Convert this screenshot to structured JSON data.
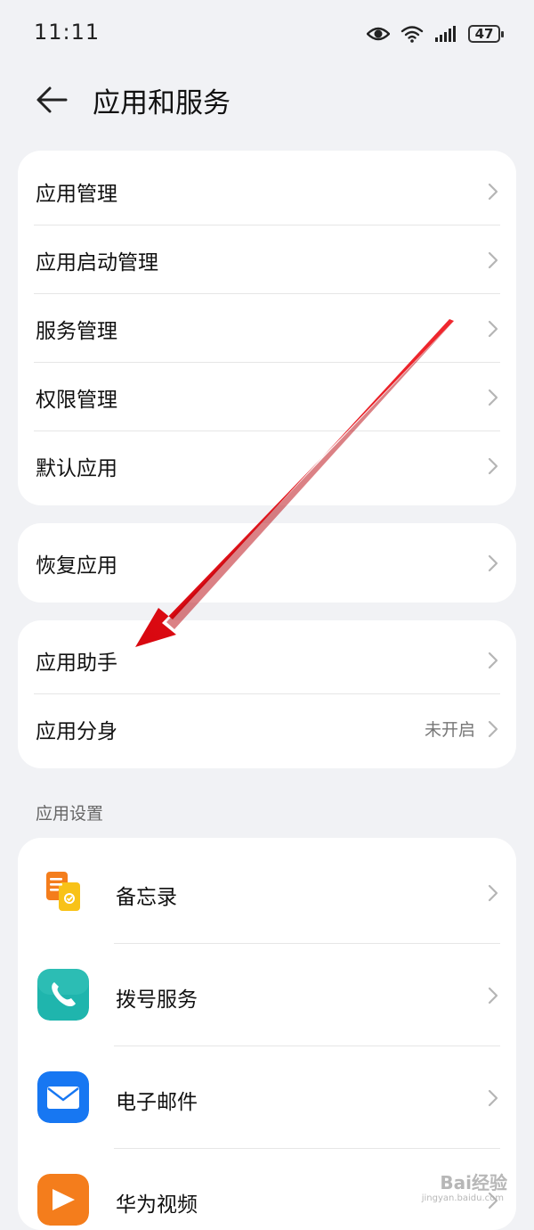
{
  "status_bar": {
    "time": "11:11",
    "battery": "47",
    "icons": [
      "eye-comfort-icon",
      "wifi-icon",
      "signal-icon",
      "battery-icon"
    ]
  },
  "header": {
    "back_icon": "back-arrow-icon",
    "title": "应用和服务"
  },
  "group1": {
    "items": [
      {
        "label": "应用管理"
      },
      {
        "label": "应用启动管理"
      },
      {
        "label": "服务管理"
      },
      {
        "label": "权限管理"
      },
      {
        "label": "默认应用"
      }
    ]
  },
  "group2": {
    "items": [
      {
        "label": "恢复应用"
      }
    ]
  },
  "group3": {
    "items": [
      {
        "label": "应用助手",
        "value": ""
      },
      {
        "label": "应用分身",
        "value": "未开启"
      }
    ]
  },
  "app_settings": {
    "section_title": "应用设置",
    "apps": [
      {
        "label": "备忘录",
        "icon": "notepad-icon",
        "color": "#f47d1c"
      },
      {
        "label": "拨号服务",
        "icon": "phone-icon",
        "color": "#1fb5ad"
      },
      {
        "label": "电子邮件",
        "icon": "mail-icon",
        "color": "#1777f2"
      },
      {
        "label": "华为视频",
        "icon": "video-icon",
        "color": "#f47d1c"
      }
    ]
  },
  "annotation": {
    "color": "#e8101a"
  },
  "watermark": {
    "text": "Bai经验",
    "sub": "jingyan.baidu.com"
  }
}
